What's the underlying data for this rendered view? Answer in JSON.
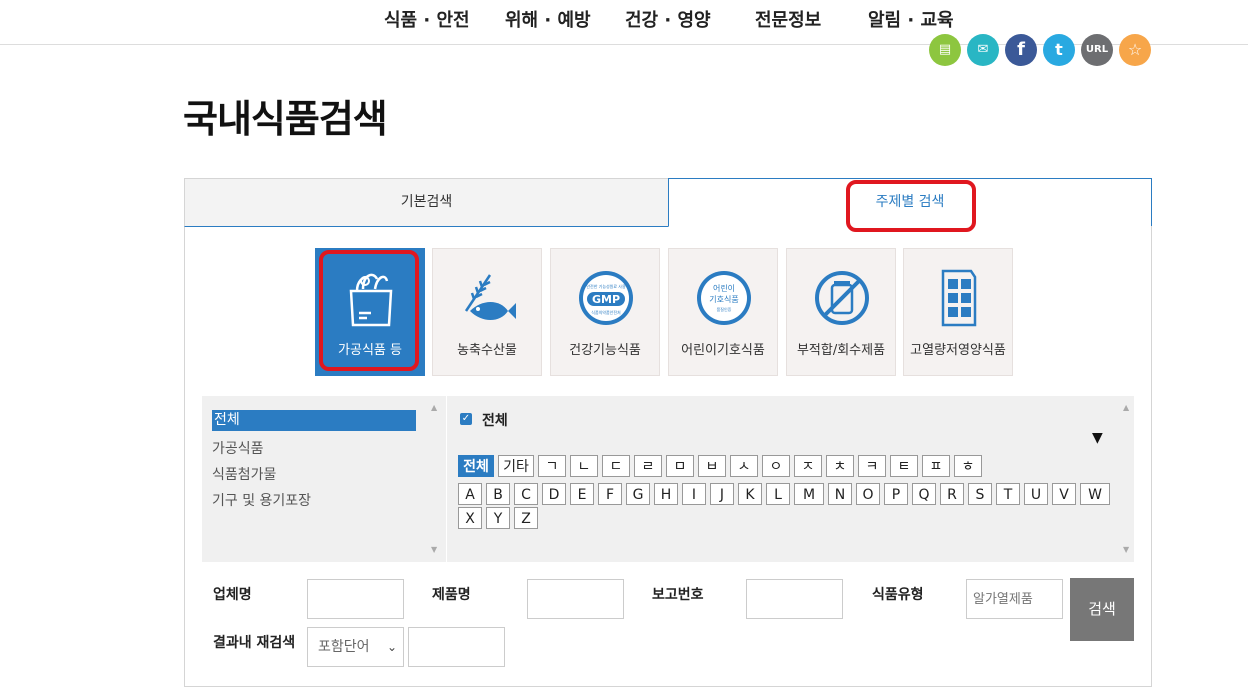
{
  "topnav": [
    "식품 · 안전",
    "위해 · 예방",
    "건강 · 영양",
    "전문정보",
    "알림 · 교육"
  ],
  "share_icons": [
    {
      "name": "print-icon",
      "color": "#8dc63f",
      "glyph": "▤"
    },
    {
      "name": "mail-icon",
      "color": "#29b6c4",
      "glyph": "✉"
    },
    {
      "name": "facebook-icon",
      "color": "#3b5998",
      "glyph": "f"
    },
    {
      "name": "twitter-icon",
      "color": "#29a9e1",
      "glyph": "t"
    },
    {
      "name": "url-icon",
      "color": "#6d6e71",
      "glyph": "URL"
    },
    {
      "name": "favorite-icon",
      "color": "#f7a64a",
      "glyph": "☆"
    }
  ],
  "page_title": "국내식품검색",
  "tabs": {
    "basic": "기본검색",
    "topic": "주제별 검색"
  },
  "categories": [
    "가공식품 등",
    "농축수산물",
    "건강기능식품",
    "어린이기호식품",
    "부적합/회수제품",
    "고열량저영양식품"
  ],
  "category_icon_text": {
    "gmp_small": "안전한 기능성원료 사용",
    "gmp": "GMP",
    "gmp_bottom": "식품의약품안전처",
    "kids_top": "어린이",
    "kids_mid": "기호식품",
    "kids_small": "품질인증"
  },
  "left_list": [
    "전체",
    "가공식품",
    "식품첨가물",
    "기구 및 용기포장"
  ],
  "check_label": "전체",
  "keys_row1": [
    "전체",
    "기타",
    "ㄱ",
    "ㄴ",
    "ㄷ",
    "ㄹ",
    "ㅁ",
    "ㅂ",
    "ㅅ",
    "ㅇ",
    "ㅈ",
    "ㅊ",
    "ㅋ",
    "ㅌ",
    "ㅍ",
    "ㅎ"
  ],
  "keys_row2": [
    "A",
    "B",
    "C",
    "D",
    "E",
    "F",
    "G",
    "H",
    "I",
    "J",
    "K",
    "L",
    "M",
    "N",
    "O",
    "P",
    "Q",
    "R",
    "S",
    "T",
    "U",
    "V",
    "W"
  ],
  "keys_row3": [
    "X",
    "Y",
    "Z"
  ],
  "form": {
    "company_label": "업체명",
    "product_label": "제품명",
    "report_label": "보고번호",
    "type_label": "식품유형",
    "type_placeholder": "알가열제품",
    "search_button": "검색",
    "refine_label": "결과내 재검색",
    "refine_select": "포함단어"
  },
  "colors": {
    "accent": "#2b7cc2",
    "highlight": "#e0171f"
  }
}
